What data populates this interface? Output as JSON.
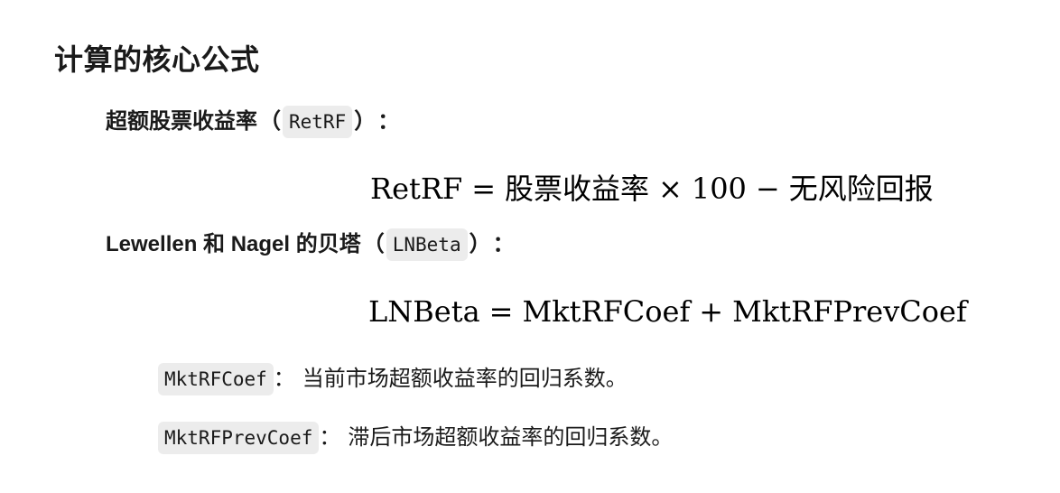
{
  "title": "计算的核心公式",
  "retrf_item": {
    "label": "超额股票收益率",
    "paren_open": "（",
    "code": "RetRF",
    "paren_close": "）",
    "colon": "："
  },
  "retrf_formula": {
    "lhs": "RetRF",
    "eq": "=",
    "term1": "股票收益率",
    "times": "×",
    "num": "100",
    "minus": "−",
    "term2": "无风险回报"
  },
  "lnbeta_item": {
    "label": "Lewellen 和 Nagel 的贝塔",
    "paren_open": "（",
    "code": "LNBeta",
    "paren_close": "）",
    "colon": "："
  },
  "lnbeta_formula": {
    "lhs": "LNBeta",
    "eq": "=",
    "term1": "MktRFCoef",
    "plus": "+",
    "term2": "MktRFPrevCoef"
  },
  "definitions": [
    {
      "code": "MktRFCoef",
      "colon": "：",
      "text": "当前市场超额收益率的回归系数。"
    },
    {
      "code": "MktRFPrevCoef",
      "colon": "：",
      "text": "滞后市场超额收益率的回归系数。"
    }
  ]
}
